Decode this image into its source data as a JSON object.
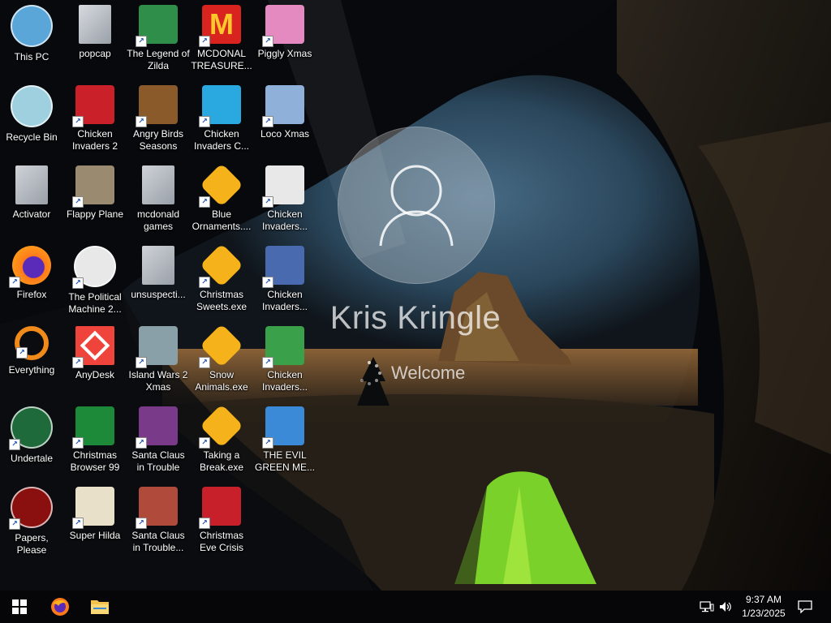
{
  "login": {
    "username": "Kris Kringle",
    "status": "Welcome"
  },
  "desktop": {
    "icons": [
      {
        "label": "This PC",
        "icon": "computer-icon",
        "color": "#5aa6d8"
      },
      {
        "label": "popcap",
        "icon": "folder-icon",
        "color": "#d7dbe0"
      },
      {
        "label": "The Legend of Zilda",
        "icon": "game-character-icon",
        "color": "#2f8f4a"
      },
      {
        "label": "MCDONAL TREASURE...",
        "icon": "golden-arches-icon",
        "color": "#d8231f"
      },
      {
        "label": "Piggly Xmas",
        "icon": "pig-icon",
        "color": "#e58ac0"
      },
      {
        "label": "Recycle Bin",
        "icon": "recycle-bin-icon",
        "color": "#9fd0e0"
      },
      {
        "label": "Chicken Invaders 2",
        "icon": "chicken-icon",
        "color": "#c9202a"
      },
      {
        "label": "Angry Birds Seasons",
        "icon": "angry-bird-icon",
        "color": "#8a5a2b"
      },
      {
        "label": "Chicken Invaders C...",
        "icon": "snowman-chicken-icon",
        "color": "#2aa8e0"
      },
      {
        "label": "Loco Xmas",
        "icon": "bear-icon",
        "color": "#8fb0d8"
      },
      {
        "label": "Activator",
        "icon": "blank-file-icon",
        "color": "#cfd3d8"
      },
      {
        "label": "Flappy Plane",
        "icon": "plane-icon",
        "color": "#9a8a70"
      },
      {
        "label": "mcdonald games",
        "icon": "blank-file-icon",
        "color": "#cfd3d8"
      },
      {
        "label": "Blue Ornaments....",
        "icon": "popcap-flower-icon",
        "color": "#f5b21a"
      },
      {
        "label": "Chicken Invaders...",
        "icon": "santa-chicken-icon",
        "color": "#e8e8e8"
      },
      {
        "label": "Firefox",
        "icon": "firefox-icon",
        "color": "#ff7a1a"
      },
      {
        "label": "The Political Machine 2...",
        "icon": "political-badge-icon",
        "color": "#e8e8e8"
      },
      {
        "label": "unsuspecti...",
        "icon": "blank-file-icon",
        "color": "#cfd3d8"
      },
      {
        "label": "Christmas Sweets.exe",
        "icon": "popcap-flower-icon",
        "color": "#f5b21a"
      },
      {
        "label": "Chicken Invaders...",
        "icon": "egg-ship-icon",
        "color": "#4a6ab0"
      },
      {
        "label": "Everything",
        "icon": "search-magnifier-icon",
        "color": "#f08a1a"
      },
      {
        "label": "AnyDesk",
        "icon": "anydesk-icon",
        "color": "#ef443b"
      },
      {
        "label": "Island Wars 2 Xmas",
        "icon": "island-icon",
        "color": "#8aa0a8"
      },
      {
        "label": "Snow Animals.exe",
        "icon": "popcap-flower-icon",
        "color": "#f5b21a"
      },
      {
        "label": "Chicken Invaders...",
        "icon": "chicken-gift-icon",
        "color": "#3aa04a"
      },
      {
        "label": "Undertale",
        "icon": "undertale-icon",
        "color": "#1f6a3a"
      },
      {
        "label": "Christmas Browser 99",
        "icon": "christmas-tree-icon",
        "color": "#1d8a3a"
      },
      {
        "label": "Santa Claus in Trouble",
        "icon": "santa-face-icon",
        "color": "#7a3a8a"
      },
      {
        "label": "Taking a Break.exe",
        "icon": "popcap-flower-icon",
        "color": "#f5b21a"
      },
      {
        "label": "THE EVIL GREEN ME...",
        "icon": "messenger-people-icon",
        "color": "#3a8ad8"
      },
      {
        "label": "Papers, Please",
        "icon": "papers-seal-icon",
        "color": "#8a1010"
      },
      {
        "label": "Super Hilda",
        "icon": "pixel-character-icon",
        "color": "#e8e0c8"
      },
      {
        "label": "Santa Claus in Trouble... A...",
        "icon": "santa-face-icon",
        "color": "#b04a3a"
      },
      {
        "label": "Christmas Eve Crisis",
        "icon": "santa-hat-icon",
        "color": "#c8202a"
      }
    ]
  },
  "taskbar": {
    "time": "9:37 AM",
    "date": "1/23/2025"
  }
}
